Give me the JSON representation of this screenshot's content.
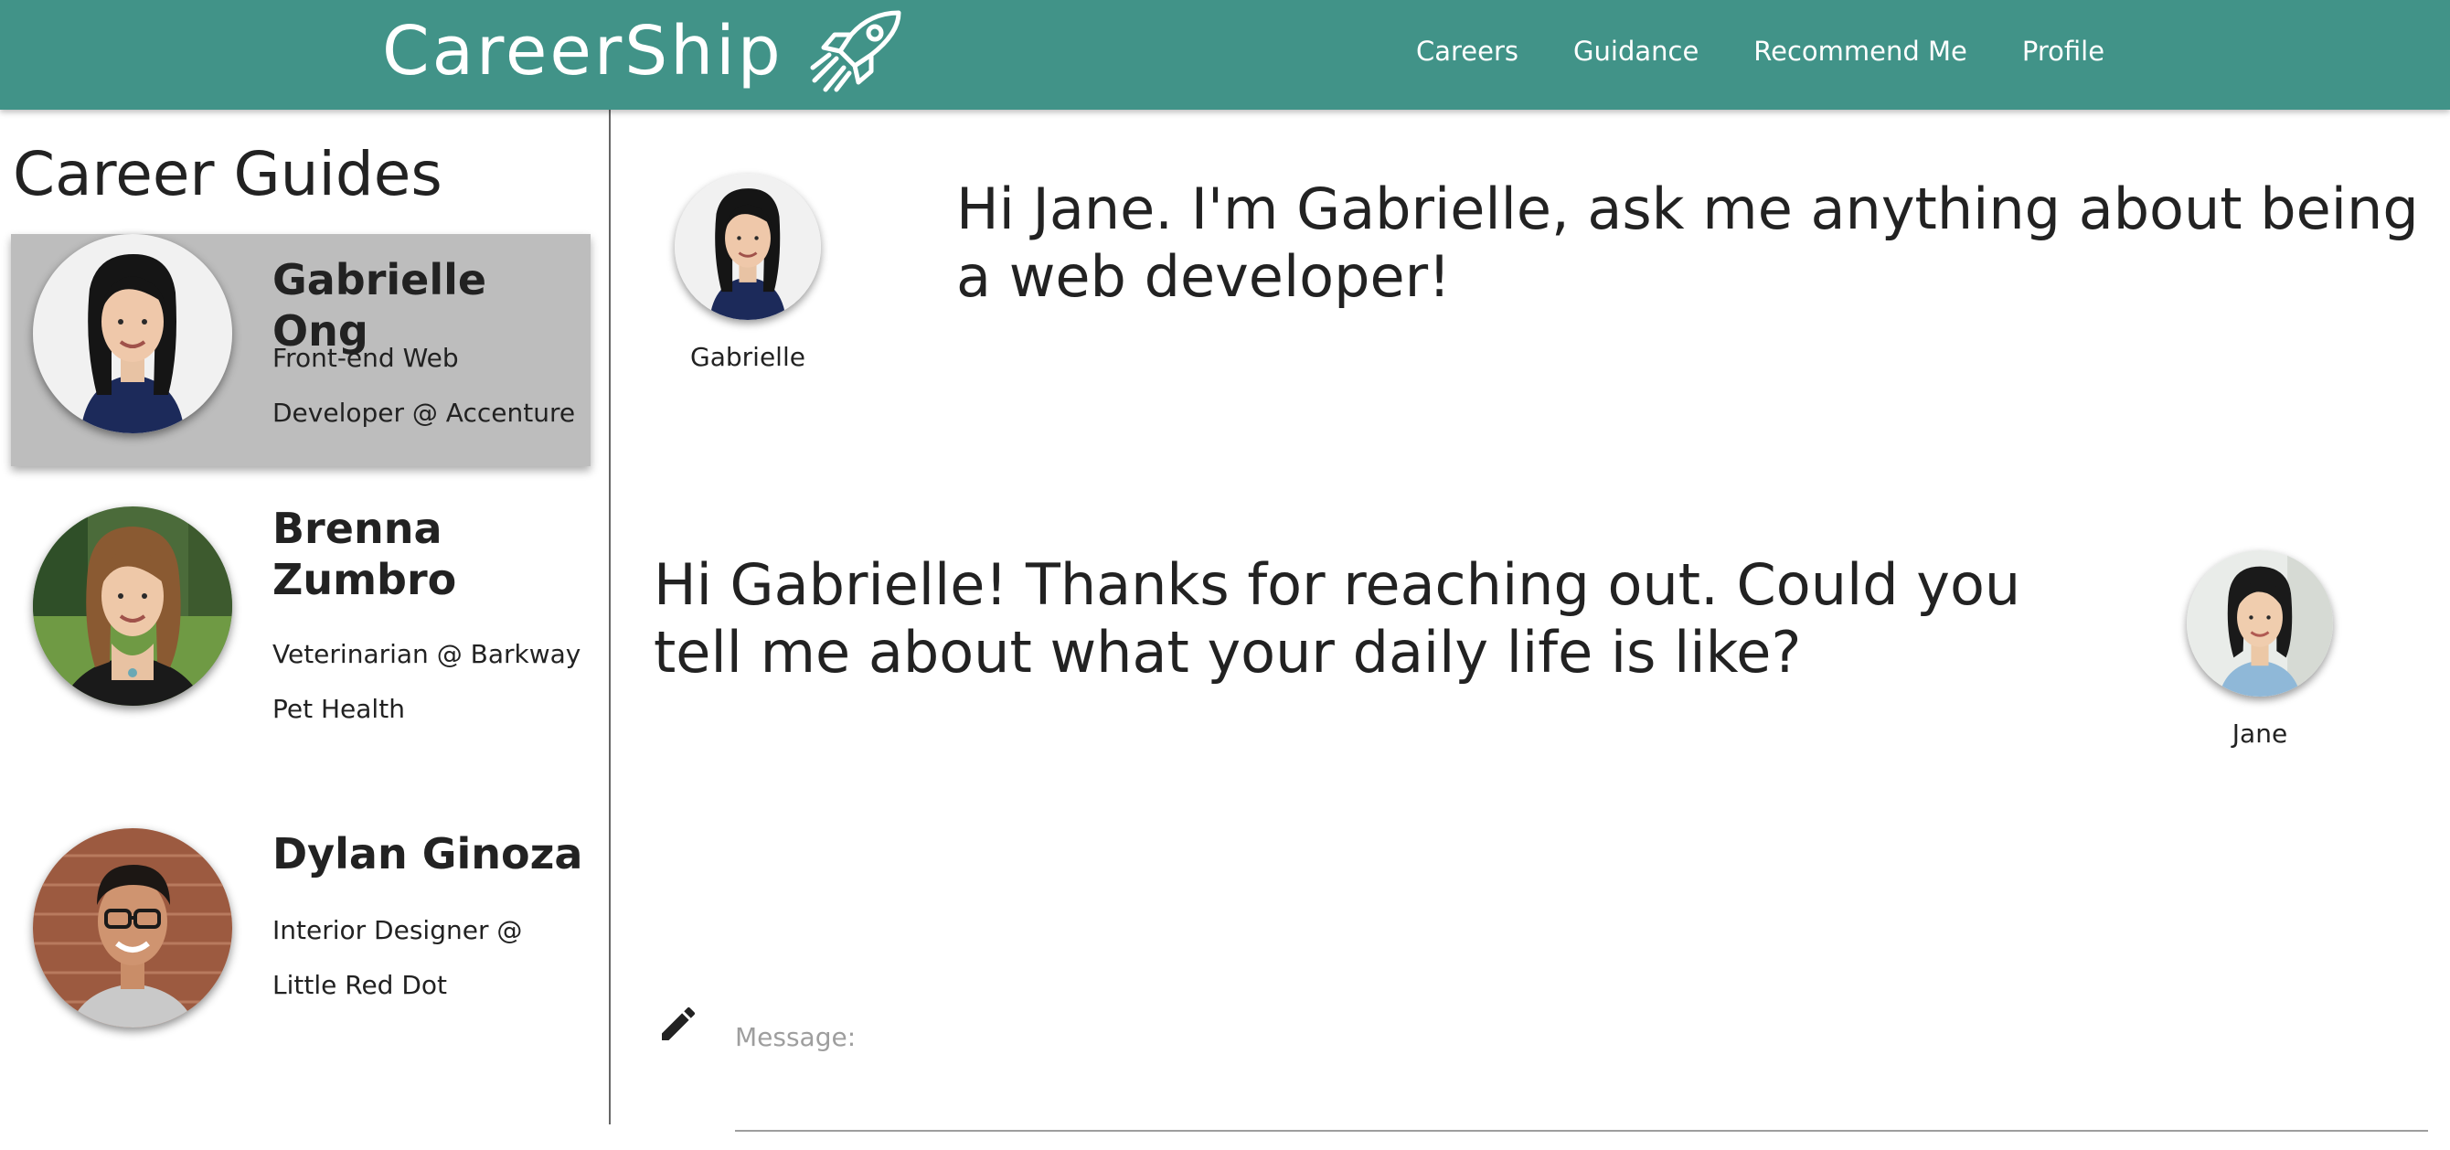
{
  "header": {
    "brand": "CareerShip",
    "brand_icon": "rocket-icon",
    "background_color": "#419388",
    "nav": [
      "Careers",
      "Guidance",
      "Recommend Me",
      "Profile"
    ]
  },
  "sidebar": {
    "title": "Career Guides",
    "guides": [
      {
        "name": "Gabrielle Ong",
        "role": "Front-end Web Developer @ Accenture",
        "active": true
      },
      {
        "name": "Brenna Zumbro",
        "role": "Veterinarian @ Barkway Pet Health",
        "active": false
      },
      {
        "name": "Dylan Ginoza",
        "role": "Interior Designer @ Little Red Dot",
        "active": false
      }
    ]
  },
  "chat": {
    "messages": [
      {
        "sender": "Gabrielle",
        "text": "Hi Jane. I'm Gabrielle, ask me anything about being a web developer!"
      },
      {
        "sender": "Jane",
        "text": "Hi Gabrielle! Thanks for reaching out. Could you tell me about what your daily life is like?"
      }
    ],
    "compose": {
      "label": "Message:",
      "value": "",
      "icon": "pencil-icon"
    }
  }
}
